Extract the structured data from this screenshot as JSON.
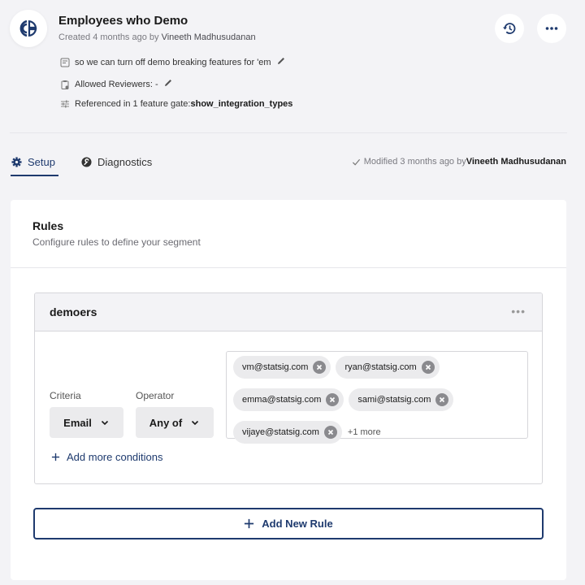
{
  "header": {
    "logo_icon": "statsig-logo-icon",
    "title": "Employees who Demo",
    "created_prefix": "Created 4 months ago by ",
    "created_by": "Vineeth Madhusudanan",
    "description": "so we can turn off demo breaking features for 'em",
    "reviewers": "Allowed Reviewers: -",
    "referenced_prefix": "Referenced in 1 feature gate: ",
    "referenced_gate": "show_integration_types",
    "history_icon": "history-icon",
    "more_icon": "more-horizontal-icon"
  },
  "tabs": [
    {
      "label": "Setup",
      "icon": "gear-icon",
      "active": true
    },
    {
      "label": "Diagnostics",
      "icon": "wrench-icon",
      "active": false
    }
  ],
  "modified": {
    "prefix": "Modified 3 months ago by ",
    "by": "Vineeth Madhusudanan"
  },
  "rules": {
    "title": "Rules",
    "subtitle": "Configure rules to define your segment",
    "rule": {
      "name": "demoers",
      "menu": "•••",
      "criteria_label": "Criteria",
      "criteria_value": "Email",
      "operator_label": "Operator",
      "operator_value": "Any of",
      "values": [
        "vm@statsig.com",
        "ryan@statsig.com",
        "emma@statsig.com",
        "sami@statsig.com",
        "vijaye@statsig.com"
      ],
      "more": "+1 more",
      "add_conditions": "Add more conditions"
    },
    "add_rule": "Add New Rule"
  },
  "colors": {
    "accent": "#1e3a6e",
    "background": "#f3f3f6",
    "chip": "#ebebed"
  }
}
